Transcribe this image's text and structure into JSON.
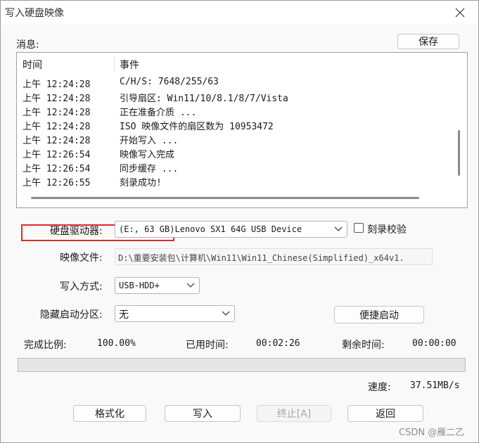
{
  "window": {
    "title": "写入硬盘映像"
  },
  "messages": {
    "label": "消息:",
    "save_label": "保存",
    "columns": [
      "时间",
      "事件"
    ],
    "rows": [
      {
        "time": "上午 12:24:28",
        "event": "C/H/S: 7648/255/63"
      },
      {
        "time": "上午 12:24:28",
        "event": "引导扇区: Win11/10/8.1/8/7/Vista"
      },
      {
        "time": "上午 12:24:28",
        "event": "正在准备介质 ..."
      },
      {
        "time": "上午 12:24:28",
        "event": "ISO 映像文件的扇区数为 10953472"
      },
      {
        "time": "上午 12:24:28",
        "event": "开始写入 ..."
      },
      {
        "time": "上午 12:26:54",
        "event": "映像写入完成"
      },
      {
        "time": "上午 12:26:54",
        "event": "同步缓存 ..."
      },
      {
        "time": "上午 12:26:55",
        "event": "刻录成功!"
      }
    ]
  },
  "form": {
    "drive_label": "硬盘驱动器:",
    "drive_value": "(E:, 63 GB)Lenovo SX1 64G USB Device",
    "verify_label": "刻录校验",
    "image_label": "映像文件:",
    "image_value": "D:\\重要安装包\\计算机\\Win11\\Win11_Chinese(Simplified)_x64v1.",
    "method_label": "写入方式:",
    "method_value": "USB-HDD+",
    "hidden_label": "隐藏启动分区:",
    "hidden_value": "无",
    "quick_boot_label": "便捷启动"
  },
  "status": {
    "percent_label": "完成比例:",
    "percent_value": "100.00%",
    "elapsed_label": "已用时间:",
    "elapsed_value": "00:02:26",
    "remaining_label": "剩余时间:",
    "remaining_value": "00:00:00",
    "progress_fraction": 1.0,
    "speed_label": "速度:",
    "speed_value": "37.51MB/s"
  },
  "actions": {
    "format_label": "格式化",
    "write_label": "写入",
    "abort_label": "终止[A]",
    "back_label": "返回"
  },
  "watermark": "CSDN @雁二乙",
  "colors": {
    "highlight": "#e02b2b",
    "window_bg": "#f9f9f9"
  }
}
